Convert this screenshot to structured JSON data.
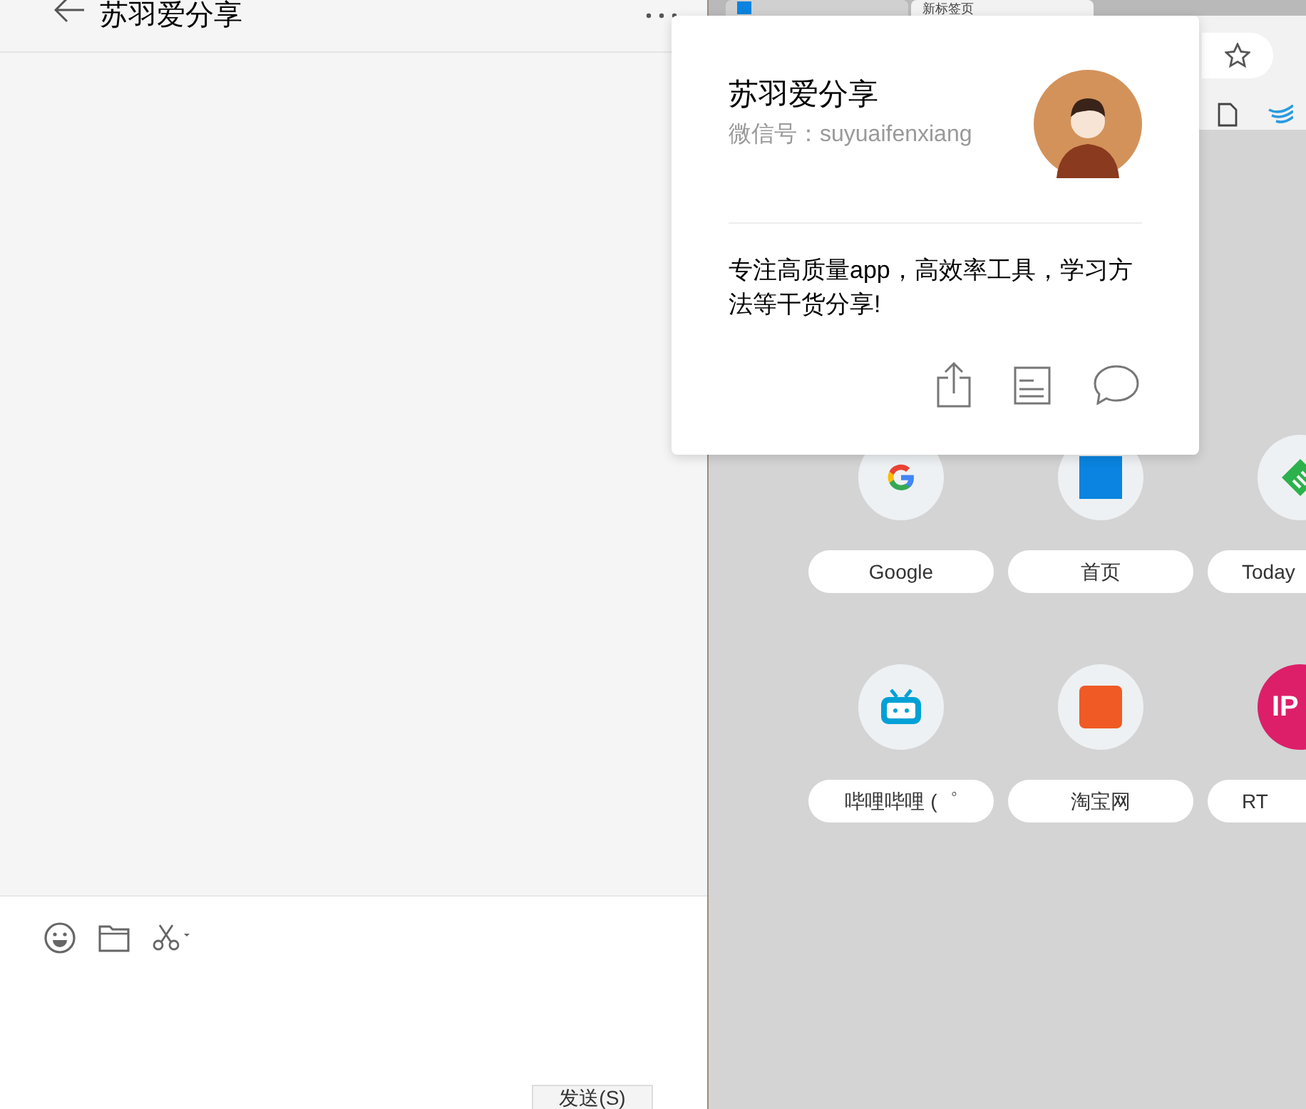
{
  "chat": {
    "title": "苏羽爱分享",
    "send_button": "发送(S)"
  },
  "browser": {
    "tabs": [
      {
        "selected": false
      },
      {
        "label": "新标签页",
        "selected": true
      }
    ],
    "tiles": [
      {
        "label": "Google",
        "kind": "google"
      },
      {
        "label": "首页",
        "kind": "zhihu"
      },
      {
        "label": "Today",
        "kind": "feedly"
      },
      {
        "label": "哔哩哔哩 (゜",
        "kind": "bilibili"
      },
      {
        "label": "淘宝网",
        "kind": "taobao"
      },
      {
        "label": "RT",
        "kind": "letter",
        "letter": "IP"
      }
    ]
  },
  "profile_card": {
    "name": "苏羽爱分享",
    "wechat_id": "微信号：suyuaifenxiang",
    "bio": "专注高质量app，高效率工具，学习方法等干货分享!"
  }
}
